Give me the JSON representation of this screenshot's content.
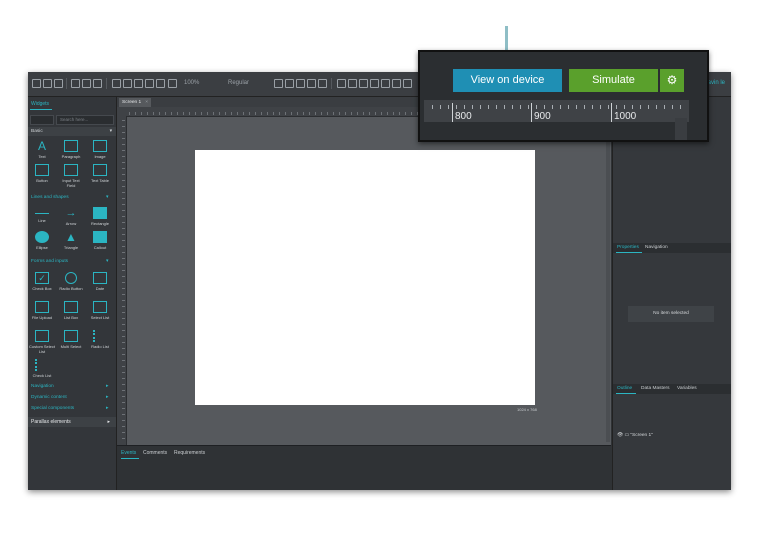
{
  "toolbar": {
    "zoom_value": "100%",
    "font_value": "Regular",
    "right_label": "ravin le"
  },
  "left_panel": {
    "tab_label": "Widgets",
    "search_placeholder": "Search here...",
    "category_basic": "Basic",
    "basic_widgets": [
      "Text",
      "Paragraph",
      "Image",
      "Button",
      "Input Text Field",
      "Text Table"
    ],
    "category_lines": "Lines and shapes",
    "lines_widgets": [
      "Line",
      "Arrow",
      "Rectangle",
      "Ellipse",
      "Triangle",
      "Callout"
    ],
    "category_forms": "Forms and inputs",
    "forms_widgets": [
      "Check Box",
      "Radio Button",
      "Date",
      "File Upload",
      "List Box",
      "Select List",
      "Custom Select List",
      "Multi Select",
      "Radio List",
      "Check List"
    ],
    "category_navigation": "Navigation",
    "category_dynamic": "Dynamic content",
    "category_special": "Special components",
    "category_parallax": "Parallax elements"
  },
  "canvas": {
    "tab_label": "Screen 1",
    "size_label": "1024 x 768"
  },
  "bottom_panel": {
    "tabs": [
      "Events",
      "Comments",
      "Requirements"
    ]
  },
  "right_panel": {
    "properties_tabs": [
      "Properties",
      "Navigation"
    ],
    "no_item_text": "No item selected",
    "outline_tabs": [
      "Outline",
      "Data Masters",
      "Variables"
    ],
    "outline_item": "\"Screen 1\""
  },
  "callout": {
    "view_on_device_label": "View on device",
    "simulate_label": "Simulate",
    "gear_icon": "gear-icon",
    "ruler_numbers": [
      "800",
      "900",
      "1000"
    ]
  },
  "colors": {
    "accent": "#2bb5c2",
    "view_on_device_bg": "#1f8fb4",
    "simulate_bg": "#5aa02c"
  }
}
